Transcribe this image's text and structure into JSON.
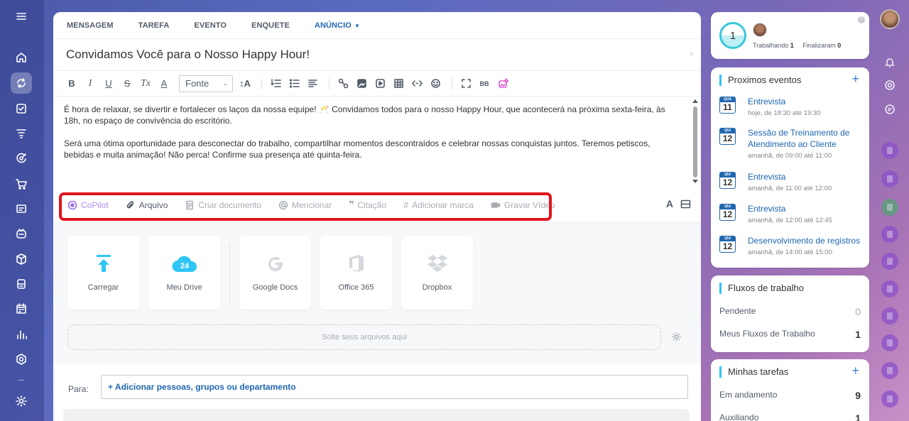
{
  "tabs": [
    {
      "label": "MENSAGEM"
    },
    {
      "label": "TAREFA"
    },
    {
      "label": "EVENTO"
    },
    {
      "label": "ENQUETE"
    },
    {
      "label": "ANÚNCIO"
    }
  ],
  "post": {
    "title": "Convidamos Você para o Nosso Happy Hour!",
    "close": "×",
    "paragraph1": "É hora de relaxar, se divertir e fortalecer os laços da nossa equipe! 🥂 Convidamos todos para o nosso Happy Hour, que acontecerá na próxima sexta-feira, às 18h, no espaço de convivência do escritório.",
    "paragraph2": "Será uma ótima oportunidade para desconectar do trabalho, compartilhar momentos descontraídos e celebrar nossas conquistas juntos. Teremos petiscos, bebidas e muita animação! Não perca! Confirme sua presença até quinta-feira."
  },
  "toolbar": {
    "bold": "B",
    "italic": "I",
    "underline": "U",
    "strike": "S",
    "clear_format": "Tx",
    "text_color": "A",
    "font_select": "Fonte",
    "font_size": "↕A"
  },
  "actions": {
    "copilot": "CoPilot",
    "file": "Arquivo",
    "create_doc": "Criar documento",
    "mention": "Mencionar",
    "quote": "Citação",
    "tag": "Adicionar marca",
    "record_video": "Gravar Vídeo",
    "format_toggle": "A"
  },
  "uploads": {
    "items": [
      {
        "label": "Carregar"
      },
      {
        "label": "Meu Drive",
        "badge": "24"
      },
      {
        "label": "Google Docs"
      },
      {
        "label": "Office 365"
      },
      {
        "label": "Dropbox"
      }
    ],
    "dropzone": "Solte seus arquivos aqui"
  },
  "recipients": {
    "label": "Para:",
    "add_link": "+ Adicionar pessoas, grupos ou departamento"
  },
  "stats": {
    "count": "1",
    "working_label": "Trabalhando",
    "working_value": "1",
    "finished_label": "Finalizaram",
    "finished_value": "0"
  },
  "events": {
    "title": "Proximos eventos",
    "add": "+",
    "items": [
      {
        "day_abbr": "QUA",
        "day": "11",
        "title": "Entrevista",
        "time": "hoje, de 18:30 até 19:30"
      },
      {
        "day_abbr": "QUI",
        "day": "12",
        "title": "Sessão de Treinamento de Atendimento ao Cliente",
        "time": "amanhã, de 09:00 até 11:00"
      },
      {
        "day_abbr": "QUI",
        "day": "12",
        "title": "Entrevista",
        "time": "amanhã, de 11:00 até 12:00"
      },
      {
        "day_abbr": "QUI",
        "day": "12",
        "title": "Entrevista",
        "time": "amanhã, de 12:00 até 12:45"
      },
      {
        "day_abbr": "QUI",
        "day": "12",
        "title": "Desenvolvimento de registros",
        "time": "amanhã, de 14:00 até 15:00"
      }
    ]
  },
  "workflows": {
    "title": "Fluxos de trabalho",
    "rows": [
      {
        "label": "Pendente",
        "value": "0"
      },
      {
        "label": "Meus Fluxos de Trabalho",
        "value": "1"
      }
    ]
  },
  "tasks": {
    "title": "Minhas tarefas",
    "add": "+",
    "rows": [
      {
        "label": "Em andamento",
        "value": "9"
      },
      {
        "label": "Auxiliando",
        "value": "1"
      }
    ]
  },
  "colors": {
    "accent": "#2067b0",
    "highlight": "#e0141e",
    "copilot": "#9b6cf0"
  }
}
